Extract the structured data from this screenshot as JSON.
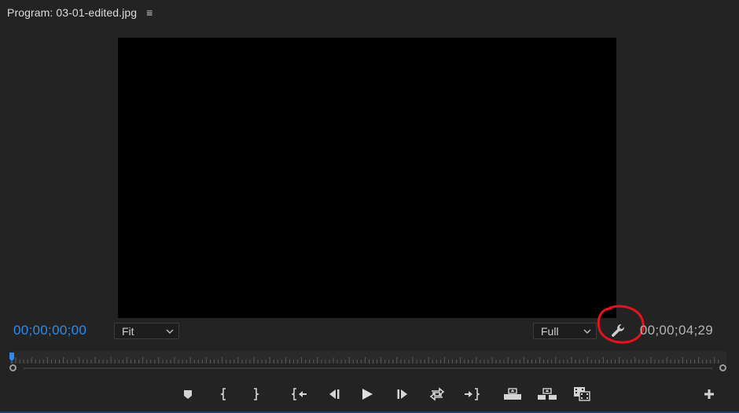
{
  "panel": {
    "title": "Program: 03-01-edited.jpg",
    "menu_icon": "hamburger-menu-icon"
  },
  "timecode": {
    "current": "00;00;00;00",
    "duration": "00;00;04;29"
  },
  "zoom": {
    "selected": "Fit"
  },
  "resolution": {
    "selected": "Full"
  },
  "settings": {
    "icon": "wrench-icon"
  },
  "transport": {
    "buttons": [
      {
        "name": "add-marker-button",
        "icon": "marker-icon"
      },
      {
        "name": "mark-in-button",
        "icon": "mark-in-icon"
      },
      {
        "name": "mark-out-button",
        "icon": "mark-out-icon"
      },
      {
        "name": "go-to-in-button",
        "icon": "go-to-in-icon"
      },
      {
        "name": "step-back-button",
        "icon": "step-back-icon"
      },
      {
        "name": "play-button",
        "icon": "play-icon"
      },
      {
        "name": "step-forward-button",
        "icon": "step-forward-icon"
      },
      {
        "name": "go-to-out-button",
        "icon": "go-to-out-icon"
      },
      {
        "name": "lift-button",
        "icon": "lift-icon"
      },
      {
        "name": "extract-button",
        "icon": "extract-icon"
      },
      {
        "name": "export-frame-button",
        "icon": "camera-icon"
      },
      {
        "name": "button-editor-button",
        "icon": "plus-icon"
      }
    ]
  },
  "colors": {
    "background": "#232323",
    "timecode_current": "#2d8ceb",
    "timecode_duration": "#b4b4b4",
    "annotation": "#e0141e",
    "playhead": "#2d8ceb"
  }
}
